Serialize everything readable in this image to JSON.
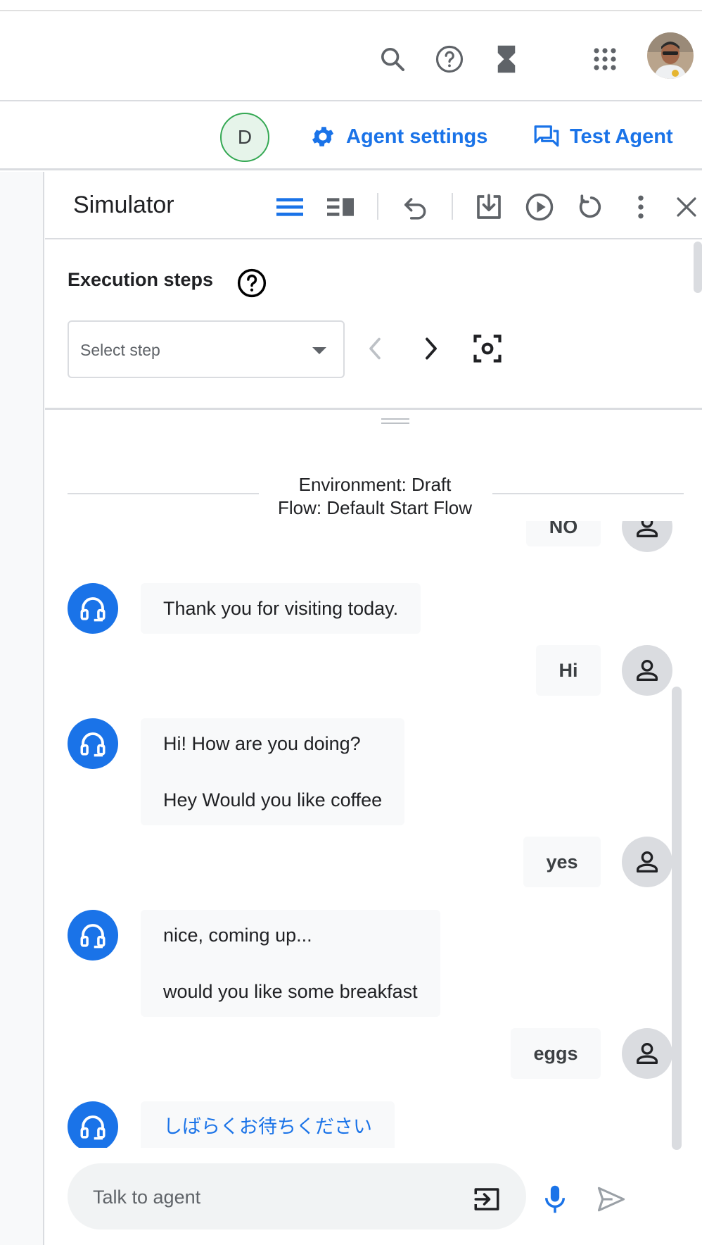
{
  "topbar": {
    "icons": [
      "search-icon",
      "help-icon",
      "hourglass-icon",
      "apps-grid-icon",
      "account-avatar"
    ]
  },
  "agent_bar": {
    "badge_letter": "D",
    "agent_settings_label": "Agent settings",
    "test_agent_label": "Test Agent"
  },
  "simulator": {
    "title": "Simulator",
    "toolbar_icons": [
      "list-view-icon",
      "split-view-icon",
      "undo-icon",
      "export-icon",
      "play-icon",
      "reset-icon",
      "more-vert-icon",
      "close-icon"
    ]
  },
  "execution_steps": {
    "title": "Execution steps",
    "select_placeholder": "Select step"
  },
  "environment": {
    "env_line": "Environment: Draft",
    "flow_line": "Flow: Default Start Flow"
  },
  "conversation": [
    {
      "role": "user",
      "text": "NO"
    },
    {
      "role": "agent",
      "lines": [
        "Thank you for visiting today."
      ]
    },
    {
      "role": "user",
      "text": "Hi"
    },
    {
      "role": "agent",
      "lines": [
        "Hi! How are you doing?",
        "Hey Would you like coffee"
      ]
    },
    {
      "role": "user",
      "text": "yes"
    },
    {
      "role": "agent",
      "lines": [
        "nice, coming up...",
        "would you like some breakfast"
      ]
    },
    {
      "role": "user",
      "text": "eggs"
    },
    {
      "role": "agent",
      "lines": [
        "しばらくお待ちください"
      ]
    }
  ],
  "input": {
    "placeholder": "Talk to agent"
  },
  "colors": {
    "accent": "#1a73e8",
    "agent_avatar": "#1a73e8",
    "user_avatar": "#dadce0",
    "bubble_bg": "#f8f9fa",
    "badge_border": "#34a853"
  }
}
